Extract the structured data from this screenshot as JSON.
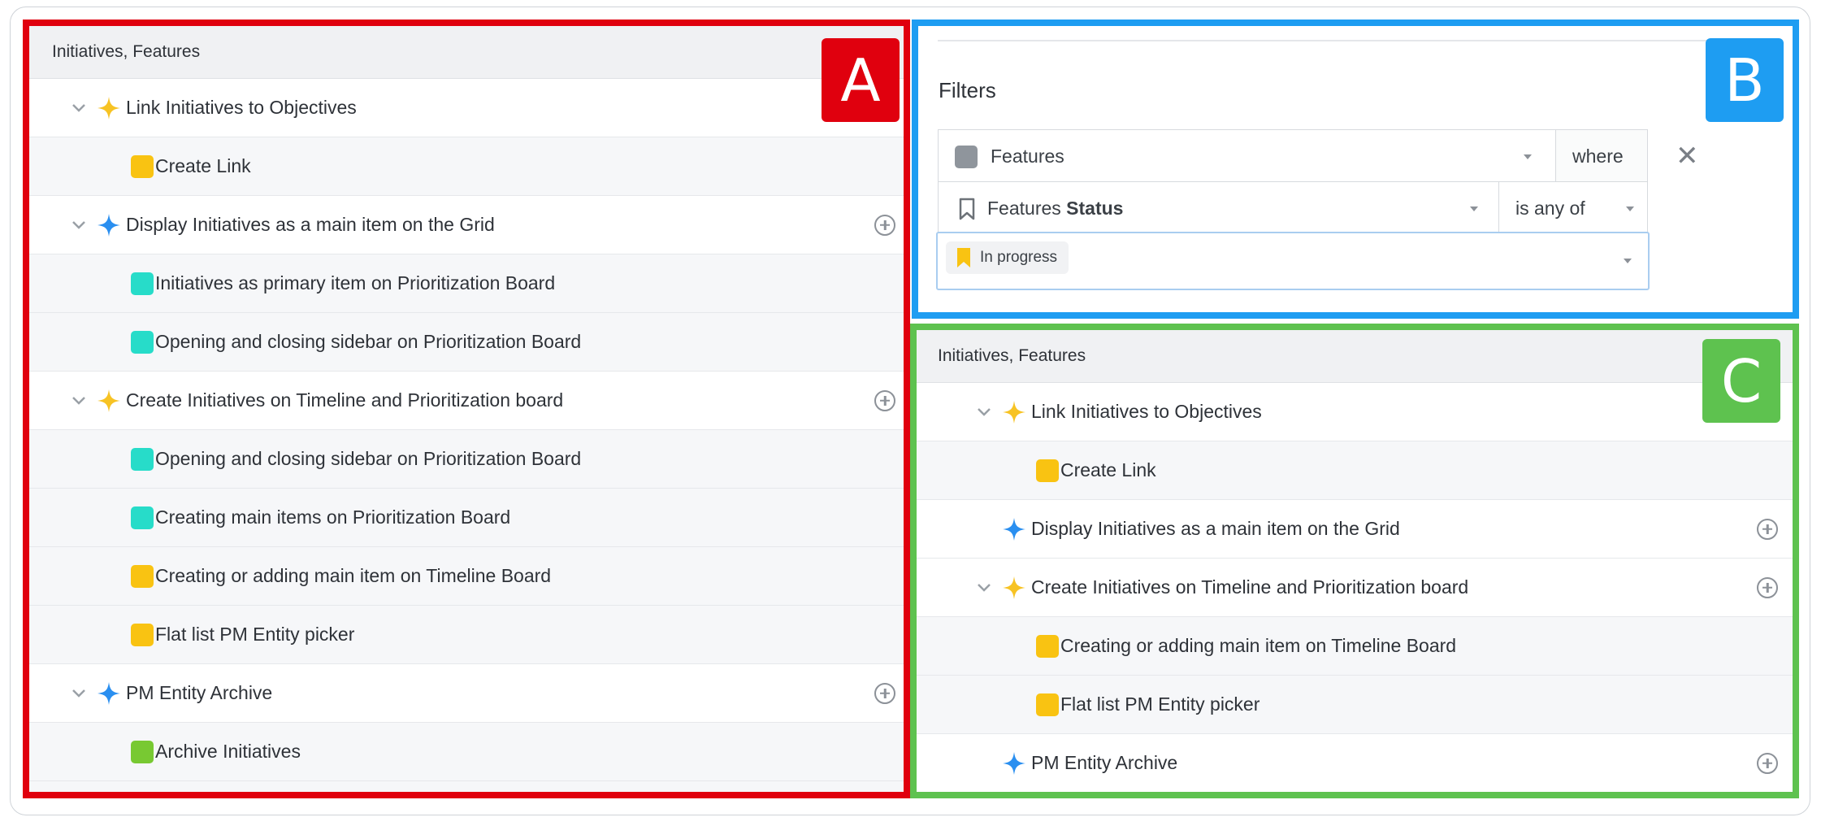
{
  "panel_a": {
    "badge": "A",
    "header": "Initiatives, Features",
    "rows": [
      {
        "label": "Link Initiatives to Objectives"
      },
      {
        "label": "Create Link"
      },
      {
        "label": "Display Initiatives as a main item on the Grid"
      },
      {
        "label": "Initiatives as primary item on Prioritization Board"
      },
      {
        "label": "Opening and closing sidebar on Prioritization Board"
      },
      {
        "label": "Create Initiatives on Timeline and Prioritization board"
      },
      {
        "label": "Opening and closing sidebar on Prioritization Board"
      },
      {
        "label": "Creating main items on Prioritization Board"
      },
      {
        "label": "Creating or adding main item on Timeline Board"
      },
      {
        "label": "Flat list PM Entity picker"
      },
      {
        "label": "PM Entity Archive"
      },
      {
        "label": "Archive Initiatives"
      }
    ]
  },
  "panel_b": {
    "badge": "B",
    "title": "Filters",
    "entity_select": "Features",
    "where_label": "where",
    "field_select_prefix": "Features",
    "field_select_bold": "Status",
    "operator_select": "is any of",
    "value_chip": "In progress",
    "remove_icon": "close-icon"
  },
  "panel_c": {
    "badge": "C",
    "header": "Initiatives, Features",
    "rows": [
      {
        "label": "Link Initiatives to Objectives"
      },
      {
        "label": "Create Link"
      },
      {
        "label": "Display Initiatives as a main item on the Grid"
      },
      {
        "label": "Create Initiatives on Timeline and Prioritization board"
      },
      {
        "label": "Creating or adding main item on Timeline Board"
      },
      {
        "label": "Flat list PM Entity picker"
      },
      {
        "label": "PM Entity Archive"
      }
    ]
  },
  "colors": {
    "panel_a_border": "#e0000e",
    "panel_b_border": "#1e9df2",
    "panel_c_border": "#5ec24f",
    "initiative_yellow": "#f7c324",
    "initiative_blue": "#2a8ff0",
    "feature_teal": "#27dcc9",
    "feature_yellow": "#f9c312",
    "feature_green": "#78c932",
    "entity_gray": "#8f959c"
  }
}
